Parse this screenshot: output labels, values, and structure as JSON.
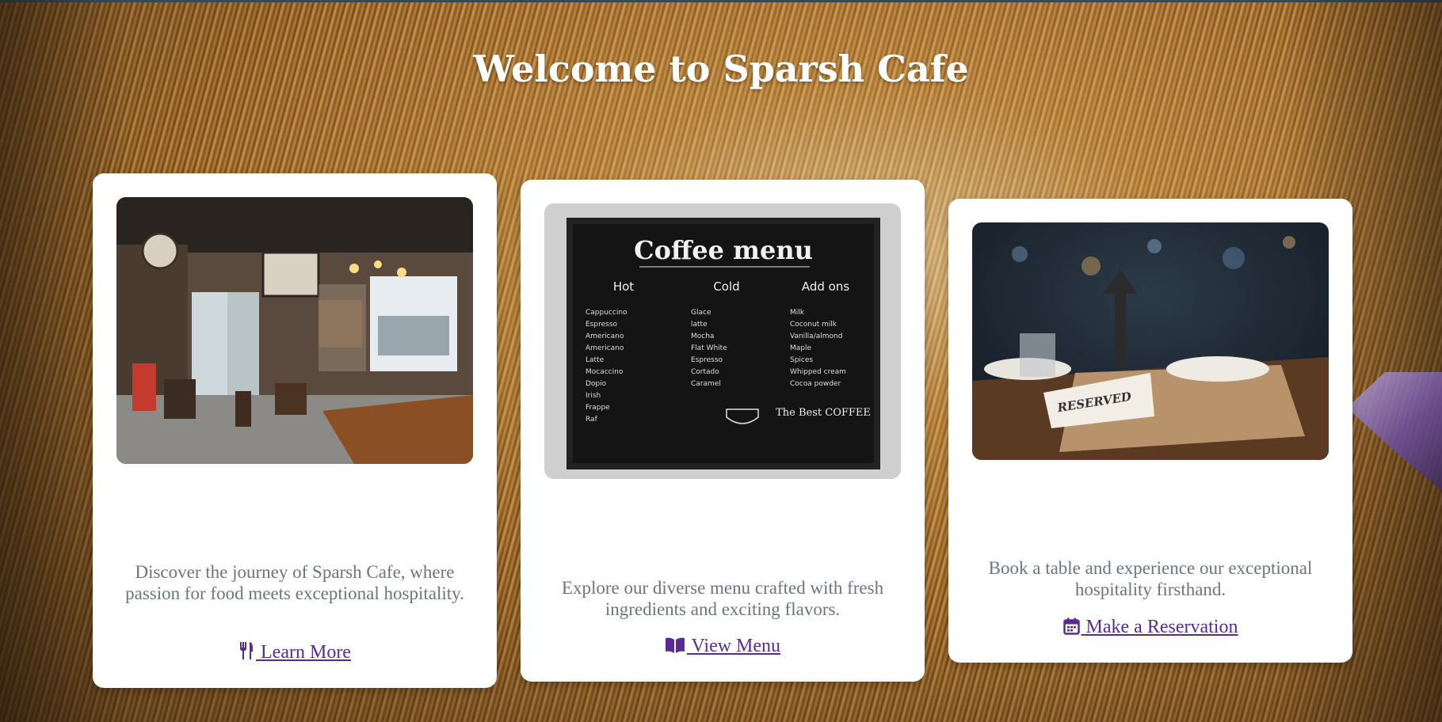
{
  "page": {
    "title": "Welcome to Sparsh Cafe"
  },
  "cards": [
    {
      "image_alt": "Cafe interior",
      "description": "Discover the journey of Sparsh Cafe, where passion for food meets exceptional hospitality.",
      "link_label": " Learn More",
      "icon": "utensils-icon"
    },
    {
      "image_alt": "Coffee menu board",
      "description": "Explore our diverse menu crafted with fresh ingredients and exciting flavors.",
      "link_label": " View Menu",
      "icon": "book-open-icon"
    },
    {
      "image_alt": "Reserved table",
      "description": "Book a table and experience our exceptional hospitality firsthand.",
      "link_label": " Make a Reservation",
      "icon": "calendar-icon"
    }
  ],
  "menu_board": {
    "heading": "Coffee menu",
    "columns": [
      "Hot",
      "Cold",
      "Add ons"
    ],
    "hot_items": [
      "Cappuccino",
      "Espresso",
      "Americano",
      "Americano",
      "Latte",
      "Mocaccino",
      "Dopio",
      "Irish",
      "Frappe",
      "Raf"
    ],
    "cold_items": [
      "Glace",
      "latte",
      "Mocha",
      "Flat White",
      "Espresso",
      "Cortado",
      "Caramel"
    ],
    "addons_items": [
      "Milk",
      "Coconut milk",
      "Vanilla/almond",
      "Maple",
      "Spices",
      "Whipped cream",
      "Cocoa powder"
    ],
    "badge": "The Best COFFEE"
  },
  "reserved_sign": "RESERVED",
  "colors": {
    "link": "#5b2a8c",
    "description": "#6c757d",
    "title": "#ffffff",
    "card_bg": "#ffffff"
  }
}
